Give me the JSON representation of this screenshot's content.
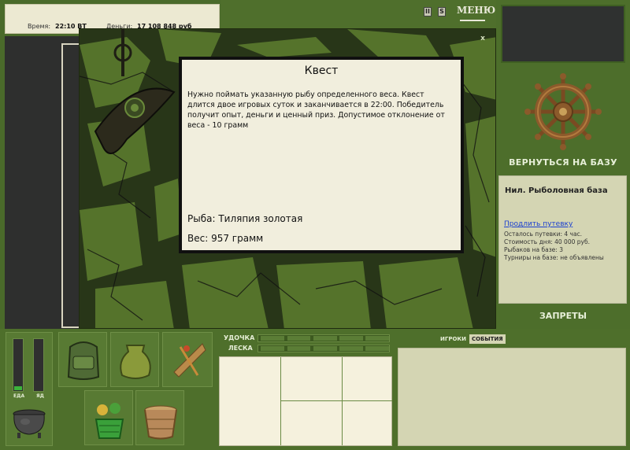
{
  "topbar": {
    "time_label": "Время:",
    "time_value": "22:10 ВТ",
    "money_label": "Деньги:",
    "money_value": "17 108 848 руб"
  },
  "header": {
    "pause_label": "II",
    "sound_label": "S",
    "menu_label": "МЕНЮ"
  },
  "scene": {
    "close_label": "x"
  },
  "quest": {
    "title": "Квест",
    "description": "Нужно поймать указанную рыбу определенного веса. Квест длится двое игровых суток и заканчивается в 22:00. Победитель получит опыт, деньги и ценный приз. Допустимое отклонение от веса - 10 грамм",
    "fish": "Рыба: Тиляпия золотая",
    "weight": "Вес: 957 грамм"
  },
  "sidebar": {
    "return_label": "ВЕРНУТЬСЯ НА БАЗУ",
    "base_title": "Нил. Рыболовная база",
    "extend_link": "Продлить путевку",
    "lines": [
      "Осталось путевки: 4 час.",
      "Стоимость дня: 40 000 руб.",
      "Рыбаков на базе: 3",
      "Турниры на базе: не объявлены"
    ],
    "bans_label": "ЗАПРЕТЫ"
  },
  "status": {
    "food_label": "ЕДА",
    "food_level": 0.08,
    "poison_label": "ЯД",
    "poison_level": 0.0
  },
  "gear": {
    "rod_label": "УДОЧКА",
    "line_label": "ЛЕСКА"
  },
  "chat": {
    "tab_players": "ИГРОКИ",
    "tab_events": "СОБЫТИЯ"
  },
  "colors": {
    "panel_green": "#4e6f2b",
    "cream": "#f1eedd",
    "link_blue": "#1a3fd0"
  }
}
